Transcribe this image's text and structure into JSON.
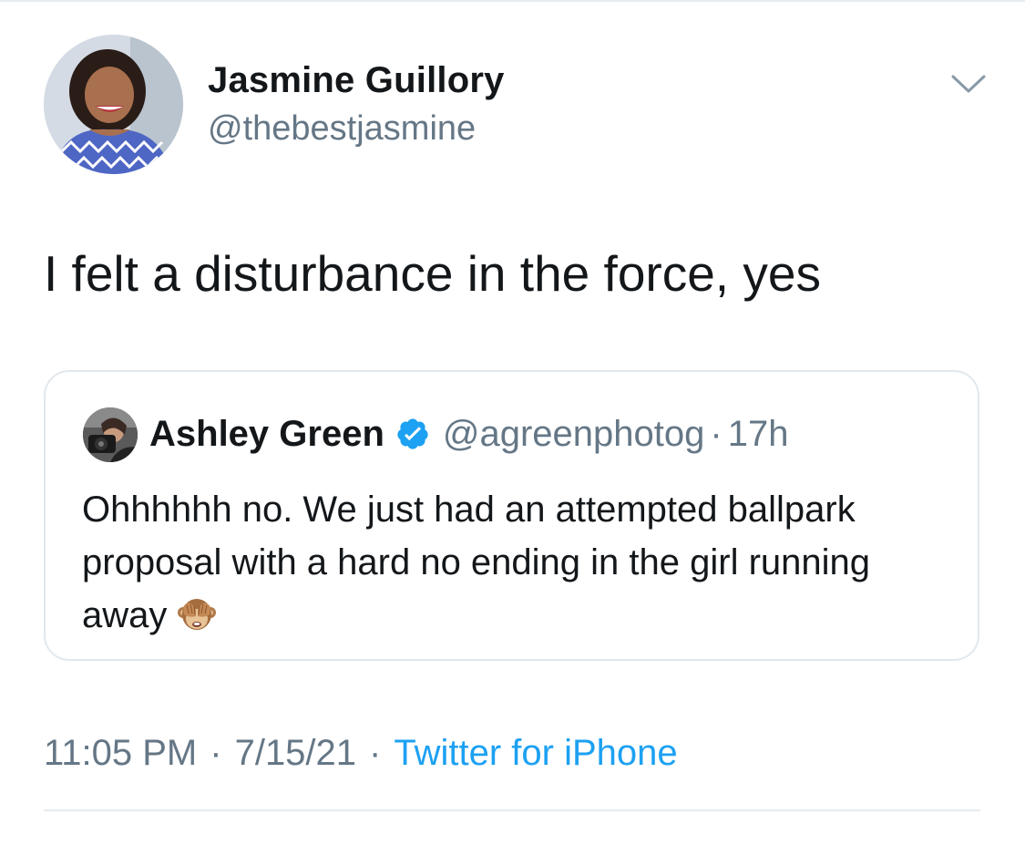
{
  "author": {
    "name": "Jasmine Guillory",
    "handle": "@thebestjasmine",
    "avatar_icon": "profile-photo-avatar"
  },
  "menu": {
    "icon": "chevron-down-icon"
  },
  "tweet": {
    "text": "I felt a disturbance in the force, yes"
  },
  "quoted_tweet": {
    "name": "Ashley Green",
    "verified": true,
    "verified_icon": "verified-badge-icon",
    "handle": "@agreenphotog",
    "separator": "·",
    "time": "17h",
    "text": "Ohhhhhh no. We just had an attempted ballpark proposal with a hard no ending in the girl running away",
    "emoji": "see-no-evil-monkey"
  },
  "meta": {
    "time": "11:05 PM",
    "separator": "·",
    "date": "7/15/21",
    "source": "Twitter for iPhone"
  },
  "colors": {
    "text": "#14171a",
    "secondary": "#657786",
    "link": "#1da1f2",
    "border": "#e1e8ed"
  }
}
